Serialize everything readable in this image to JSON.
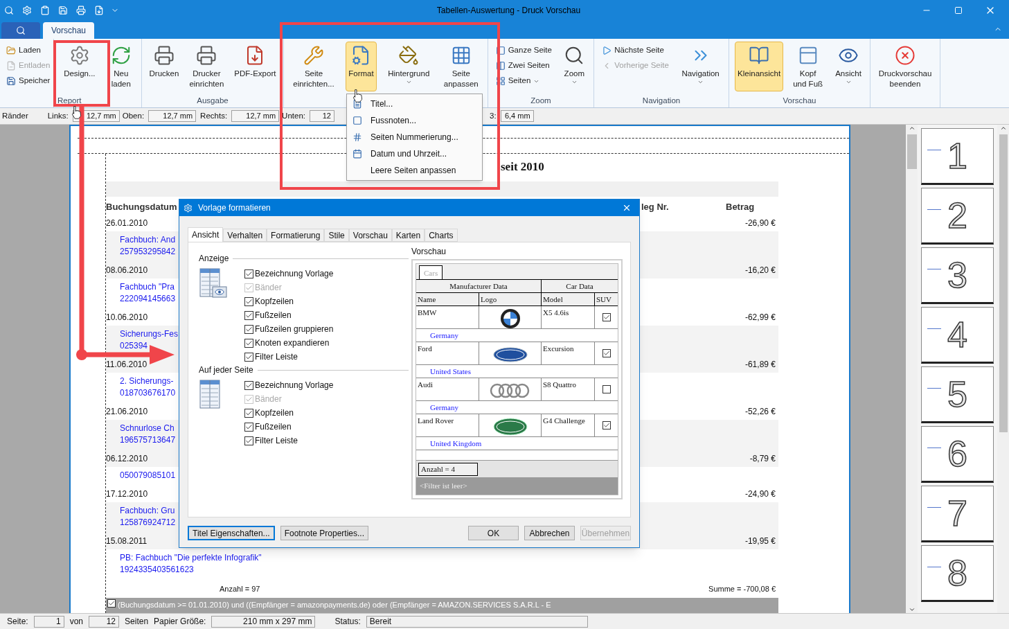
{
  "window": {
    "title": "Tabellen-Auswertung - Druck Vorschau"
  },
  "ribbon_tabs": [
    {
      "label": "Vorschau",
      "selected": true
    }
  ],
  "ribbon_groups": [
    {
      "items": [
        {
          "kind": "small",
          "label": "Laden",
          "disabled": false
        },
        {
          "kind": "small",
          "label": "Entladen",
          "disabled": true
        },
        {
          "kind": "small",
          "label": "Speicher",
          "disabled": false
        }
      ]
    },
    {
      "label": "Report",
      "items": [
        {
          "kind": "large",
          "label": "Design...",
          "selected": false,
          "dropdown": false
        },
        {
          "kind": "large",
          "label": "Neu\nladen",
          "selected": false,
          "dropdown": false
        }
      ]
    },
    {
      "label": "Ausgabe",
      "items": [
        {
          "kind": "large",
          "label": "Drucken",
          "selected": false,
          "dropdown": false
        },
        {
          "kind": "large",
          "label": "Drucker\neinrichten",
          "selected": false,
          "dropdown": false
        },
        {
          "kind": "large",
          "label": "PDF-Export",
          "selected": false,
          "dropdown": false
        }
      ]
    },
    {
      "items": [
        {
          "kind": "large",
          "label": "Seite\neinrichten...",
          "selected": false,
          "dropdown": false
        },
        {
          "kind": "large",
          "label": "Format",
          "selected": true,
          "dropdown": false
        },
        {
          "kind": "large",
          "label": "Hintergrund",
          "selected": false,
          "dropdown": true
        },
        {
          "kind": "large",
          "label": "Seite\nanpassen",
          "selected": false,
          "dropdown": false
        }
      ]
    },
    {
      "label": "Zoom",
      "items": [
        {
          "kind": "small",
          "label": "Ganze Seite",
          "disabled": false
        },
        {
          "kind": "small",
          "label": "Zwei Seiten",
          "disabled": false
        },
        {
          "kind": "small",
          "label": "Seiten",
          "disabled": false,
          "dropdown": true
        },
        {
          "kind": "large",
          "label": "Zoom",
          "selected": false,
          "dropdown": true
        }
      ]
    },
    {
      "label": "Navigation",
      "items": [
        {
          "kind": "small",
          "label": "Nächste Seite",
          "disabled": false
        },
        {
          "kind": "small",
          "label": "Vorherige Seite",
          "disabled": true
        },
        {
          "kind": "large",
          "label": "Navigation",
          "selected": false,
          "dropdown": true
        }
      ]
    },
    {
      "label": "Vorschau",
      "items": [
        {
          "kind": "large",
          "label": "Kleinansicht",
          "selected": true,
          "dropdown": false
        },
        {
          "kind": "large",
          "label": "Kopf\nund Fuß",
          "selected": false,
          "dropdown": false
        },
        {
          "kind": "large",
          "label": "Ansicht",
          "selected": false,
          "dropdown": true
        }
      ]
    },
    {
      "items": [
        {
          "kind": "large",
          "label": "Druckvorschau\nbeenden",
          "selected": false,
          "dropdown": false
        }
      ]
    }
  ],
  "margins": {
    "title": "Ränder",
    "fields": [
      {
        "label": "Links:",
        "value": "12,7 mm"
      },
      {
        "label": "Oben:",
        "value": "12,7 mm"
      },
      {
        "label": "Rechts:",
        "value": "12,7 mm"
      },
      {
        "label": "Unten:",
        "value": "12"
      },
      {
        "label": "3:",
        "value": "6,4 mm"
      }
    ]
  },
  "format_menu": [
    {
      "label": "Titel..."
    },
    {
      "label": "Fussnoten..."
    },
    {
      "label": "Seiten Nummerierung..."
    },
    {
      "label": "Datum und Uhrzeit..."
    },
    {
      "label": "Leere Seiten anpassen"
    }
  ],
  "report": {
    "title": "seit 2010",
    "columns": [
      "Buchungsdatum",
      "leg Nr.",
      "Betrag"
    ],
    "rows": [
      {
        "date": "26.01.2010",
        "lines": [
          "Fachbuch: And",
          "257953295842"
        ],
        "amount": "-26,90 €"
      },
      {
        "date": "08.06.2010",
        "lines": [
          "Fachbuch \"Pra",
          "222094145663"
        ],
        "amount": "-16,20 €"
      },
      {
        "date": "10.06.2010",
        "lines": [
          "Sicherungs-Fes",
          "025394"
        ],
        "amount": "-62,99 €"
      },
      {
        "date": "11.06.2010",
        "lines": [
          "2. Sicherungs-",
          "018703676170"
        ],
        "amount": "-61,89 €"
      },
      {
        "date": "21.06.2010",
        "lines": [
          "Schnurlose Ch",
          "196575713647"
        ],
        "amount": "-52,26 €"
      },
      {
        "date": "06.12.2010",
        "lines": [
          "050079085101"
        ],
        "amount": "-8,79 €"
      },
      {
        "date": "17.12.2010",
        "lines": [
          "Fachbuch: Gru",
          "125876924712"
        ],
        "amount": "-24,90 €"
      },
      {
        "date": "15.08.2011",
        "lines": [
          "PB: Fachbuch \"Die perfekte Infografik\"",
          "1924335403561623"
        ],
        "amount": "-19,95 €"
      }
    ],
    "count": "Anzahl = 97",
    "sum": "Summe = -700,08 €",
    "filter": {
      "checked": true,
      "text": "(Buchungsdatum >= 01.01.2010) und ((Empfänger = amazonpayments.de) oder (Empfänger = AMAZON.SERVICES S.A.R.L - E"
    }
  },
  "thumbnails": [
    {
      "label": "1"
    },
    {
      "label": "2"
    },
    {
      "label": "3"
    },
    {
      "label": "4"
    },
    {
      "label": "5"
    },
    {
      "label": "6"
    },
    {
      "label": "7"
    },
    {
      "label": "8"
    }
  ],
  "dialog": {
    "title": "Vorlage formatieren",
    "tabs": [
      {
        "label": "Ansicht",
        "selected": true
      },
      {
        "label": "Verhalten",
        "selected": false
      },
      {
        "label": "Formatierung",
        "selected": false
      },
      {
        "label": "Stile",
        "selected": false
      },
      {
        "label": "Vorschau",
        "selected": false
      },
      {
        "label": "Karten",
        "selected": false
      },
      {
        "label": "Charts",
        "selected": false
      }
    ],
    "sections": [
      {
        "title": "Anzeige",
        "options": [
          {
            "label": "Bezeichnung Vorlage",
            "checked": true,
            "disabled": false
          },
          {
            "label": "Bänder",
            "checked": true,
            "disabled": true
          },
          {
            "label": "Kopfzeilen",
            "checked": true,
            "disabled": false
          },
          {
            "label": "Fußzeilen",
            "checked": true,
            "disabled": false
          },
          {
            "label": "Fußzeilen gruppieren",
            "checked": true,
            "disabled": false
          },
          {
            "label": "Knoten expandieren",
            "checked": true,
            "disabled": false
          },
          {
            "label": "Filter Leiste",
            "checked": true,
            "disabled": false
          }
        ]
      },
      {
        "title": "Auf jeder Seite",
        "options": [
          {
            "label": "Bezeichnung Vorlage",
            "checked": true,
            "disabled": false
          },
          {
            "label": "Bänder",
            "checked": true,
            "disabled": true
          },
          {
            "label": "Kopfzeilen",
            "checked": true,
            "disabled": false
          },
          {
            "label": "Fußzeilen",
            "checked": true,
            "disabled": false
          },
          {
            "label": "Filter Leiste",
            "checked": true,
            "disabled": false
          }
        ]
      }
    ],
    "preview": {
      "title": "Vorschau",
      "tab": "Cars",
      "group_headers": [
        "Manufacturer Data",
        "Car Data"
      ],
      "columns": [
        "Name",
        "Logo",
        "Model",
        "SUV"
      ],
      "rows": [
        {
          "name": "BMW",
          "model": "X5 4.6is",
          "suv": true,
          "country": "Germany"
        },
        {
          "name": "Ford",
          "model": "Excursion",
          "suv": true,
          "country": "United States"
        },
        {
          "name": "Audi",
          "model": "S8 Quattro",
          "suv": false,
          "country": "Germany"
        },
        {
          "name": "Land Rover",
          "model": "G4 Challenge",
          "suv": true,
          "country": "United Kingdom"
        }
      ],
      "count": "Anzahl = 4",
      "filter": "<Filter ist leer>"
    },
    "left_buttons": [
      {
        "label": "Titel Eigenschaften...",
        "focused": true
      },
      {
        "label": "Footnote Properties...",
        "focused": false
      }
    ],
    "buttons": [
      {
        "label": "OK",
        "disabled": false
      },
      {
        "label": "Abbrechen",
        "disabled": false
      },
      {
        "label": "Übernehmen",
        "disabled": true
      }
    ]
  },
  "status_bar": {
    "page_label": "Seite:",
    "page": "1",
    "of_label": "von",
    "total": "12",
    "pages_label": "Seiten",
    "paper_label": "Papier Größe:",
    "paper": "210 mm x 297 mm",
    "status_label": "Status:",
    "status": "Bereit"
  }
}
